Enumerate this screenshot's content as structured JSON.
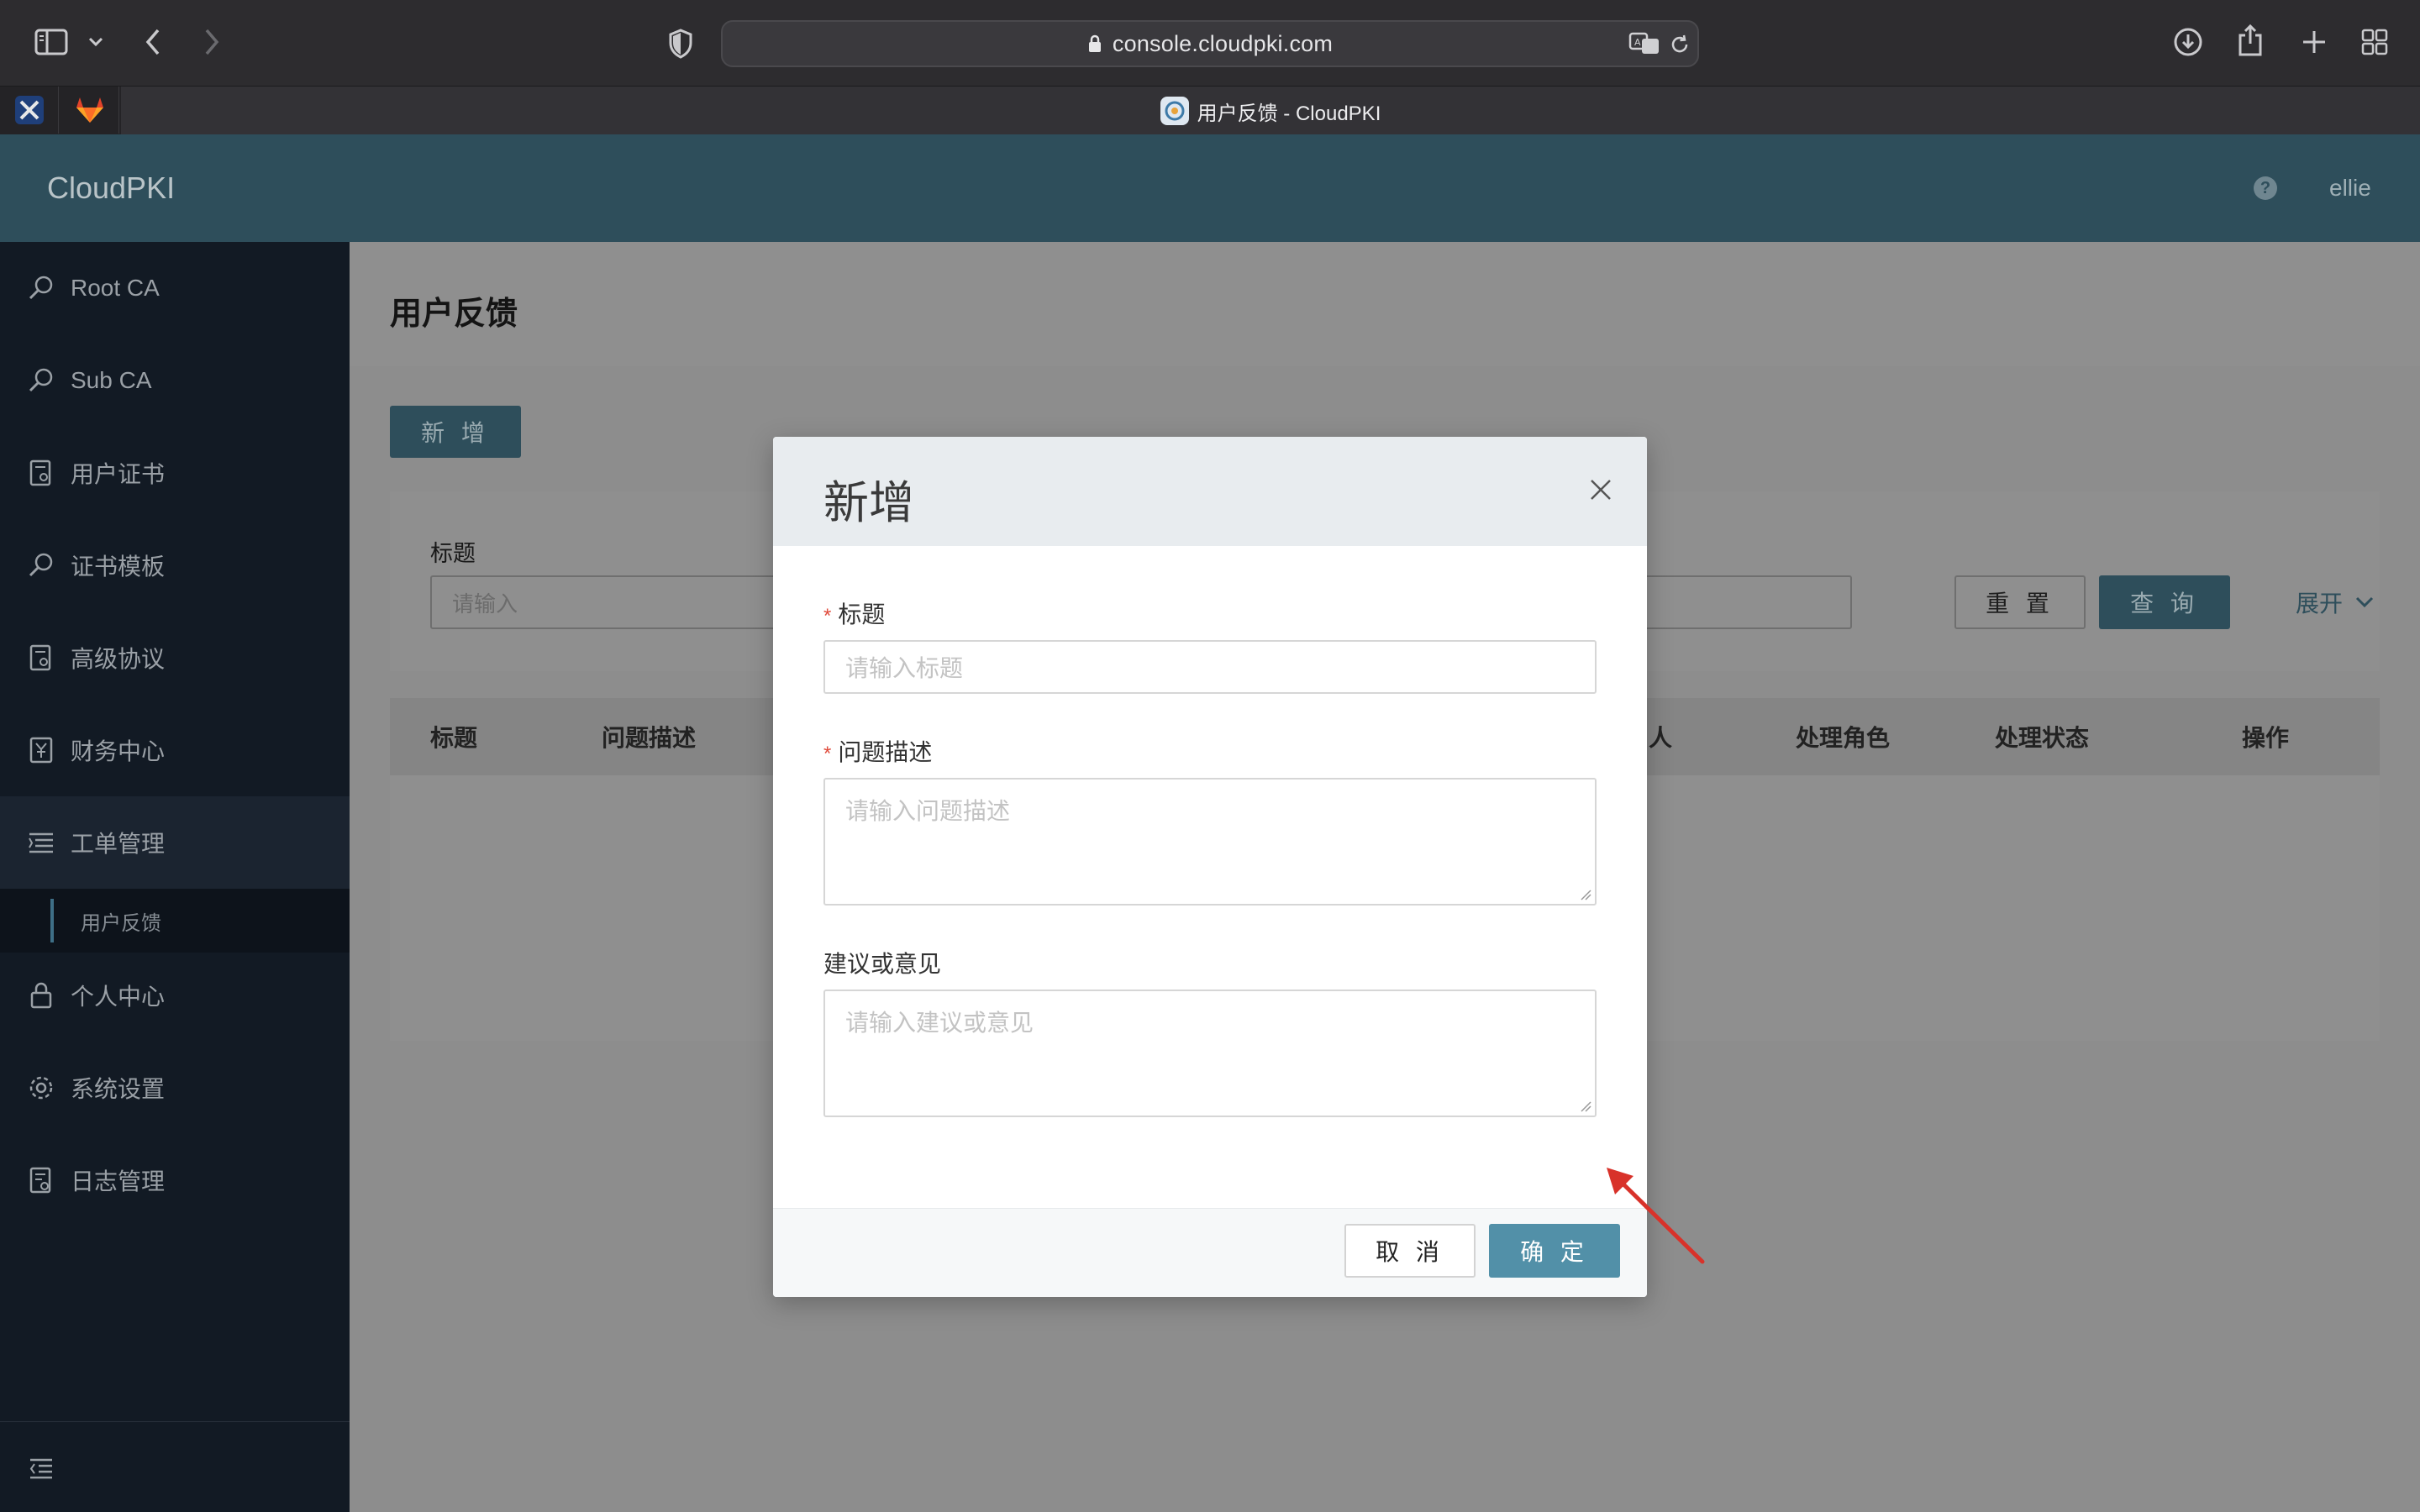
{
  "browser": {
    "url": "console.cloudpki.com",
    "tab_title": "用户反馈 - CloudPKI"
  },
  "app": {
    "logo": "CloudPKI",
    "help_icon": "?",
    "user": "ellie"
  },
  "sidebar": {
    "items": [
      {
        "label": "Root CA",
        "icon": "search-icon"
      },
      {
        "label": "Sub CA",
        "icon": "search-icon"
      },
      {
        "label": "用户证书",
        "icon": "certificate-icon"
      },
      {
        "label": "证书模板",
        "icon": "search-icon"
      },
      {
        "label": "高级协议",
        "icon": "certificate-icon"
      },
      {
        "label": "财务中心",
        "icon": "yen-icon"
      },
      {
        "label": "工单管理",
        "icon": "list-icon"
      },
      {
        "label": "个人中心",
        "icon": "lock-icon"
      },
      {
        "label": "系统设置",
        "icon": "gear-icon"
      },
      {
        "label": "日志管理",
        "icon": "log-icon"
      }
    ],
    "sub_item": "用户反馈"
  },
  "page": {
    "title": "用户反馈",
    "new_button": "新 增",
    "filter": {
      "label": "标题",
      "placeholder": "请输入",
      "reset": "重 置",
      "query": "查 询",
      "expand": "展开"
    },
    "table": {
      "columns": [
        "标题",
        "问题描述",
        "人",
        "处理角色",
        "处理状态",
        "操作"
      ]
    }
  },
  "modal": {
    "title": "新增",
    "fields": [
      {
        "label": "标题",
        "required": "*",
        "placeholder": "请输入标题"
      },
      {
        "label": "问题描述",
        "required": "*",
        "placeholder": "请输入问题描述"
      },
      {
        "label": "建议或意见",
        "placeholder": "请输入建议或意见"
      }
    ],
    "cancel": "取 消",
    "ok": "确 定"
  },
  "colors": {
    "header": "#2e4e5b",
    "sidebar": "#121a24",
    "primary_button": "#5290a8",
    "required": "#e04b3c",
    "annotation_arrow": "#d8322a"
  }
}
